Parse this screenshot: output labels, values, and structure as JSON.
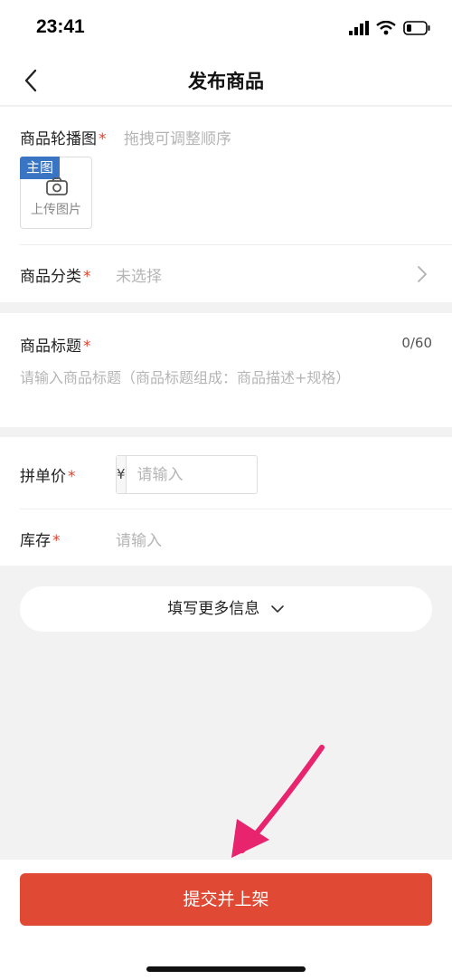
{
  "status_bar": {
    "time": "23:41"
  },
  "nav": {
    "title": "发布商品"
  },
  "images": {
    "label": "商品轮播图",
    "required_mark": "*",
    "hint": "拖拽可调整顺序",
    "main_badge": "主图",
    "upload_label": "上传图片"
  },
  "category": {
    "label": "商品分类",
    "required_mark": "*",
    "value": "未选择"
  },
  "title_field": {
    "label": "商品标题",
    "required_mark": "*",
    "counter": "0/60",
    "placeholder": "请输入商品标题（商品标题组成：商品描述+规格）"
  },
  "price": {
    "label": "拼单价",
    "required_mark": "*",
    "currency": "¥",
    "placeholder": "请输入"
  },
  "stock": {
    "label": "库存",
    "required_mark": "*",
    "placeholder": "请输入"
  },
  "more_info": {
    "label": "填写更多信息"
  },
  "submit": {
    "label": "提交并上架"
  },
  "colors": {
    "accent": "#e04a35",
    "required": "#e2412c",
    "badge": "#3a75c4",
    "annotation_arrow": "#e8246f"
  }
}
